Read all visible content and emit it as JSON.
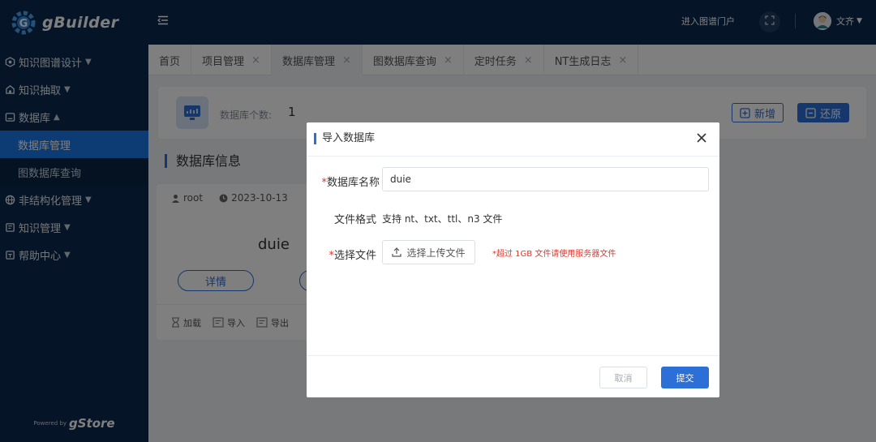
{
  "app": {
    "name": "gBuilder",
    "powered_by": "Powered by",
    "powered_brand": "gStore"
  },
  "sidebar": {
    "items": [
      {
        "label": "知识图谱设计",
        "icon": "hexagon-icon",
        "expandable": true
      },
      {
        "label": "知识抽取",
        "icon": "building-icon",
        "expandable": true
      },
      {
        "label": "数据库",
        "icon": "database-icon",
        "expandable": true,
        "children": [
          {
            "label": "数据库管理",
            "active": true
          },
          {
            "label": "图数据库查询",
            "active": false
          }
        ]
      },
      {
        "label": "非结构化管理",
        "icon": "globe-icon",
        "expandable": true
      },
      {
        "label": "知识管理",
        "icon": "book-icon",
        "expandable": true
      },
      {
        "label": "帮助中心",
        "icon": "help-doc-icon",
        "expandable": true
      }
    ]
  },
  "topbar": {
    "portal_link": "进入图谱门户",
    "user_name": "文齐"
  },
  "tabs": [
    {
      "label": "首页",
      "closable": false,
      "active": false
    },
    {
      "label": "项目管理",
      "closable": true,
      "active": false
    },
    {
      "label": "数据库管理",
      "closable": true,
      "active": true
    },
    {
      "label": "图数据库查询",
      "closable": true,
      "active": false
    },
    {
      "label": "定时任务",
      "closable": true,
      "active": false
    },
    {
      "label": "NT生成日志",
      "closable": true,
      "active": false
    }
  ],
  "summary": {
    "count_label": "数据库个数:",
    "count_value": "1",
    "add_label": "新增",
    "restore_label": "还原"
  },
  "section": {
    "title": "数据库信息"
  },
  "card": {
    "owner": "root",
    "date": "2023-10-13",
    "name": "duie",
    "detail_label": "详情",
    "actions": [
      {
        "label": "加载",
        "icon": "hourglass-icon"
      },
      {
        "label": "导入",
        "icon": "import-icon"
      },
      {
        "label": "导出",
        "icon": "export-icon"
      }
    ]
  },
  "modal": {
    "title": "导入数据库",
    "name_label": "数据库名称",
    "name_value": "duie",
    "format_label": "文件格式",
    "format_text": "支持 nt、txt、ttl、n3 文件",
    "file_label": "选择文件",
    "upload_label": "选择上传文件",
    "upload_hint": "*超过 1GB 文件请使用服务器文件",
    "required_mark": "*",
    "cancel_label": "取消",
    "submit_label": "提交"
  },
  "colors": {
    "sidebar_bg": "#0b2a4e",
    "accent": "#2c6fd6",
    "active_nav": "#1b78e8",
    "required": "#e0362c"
  }
}
